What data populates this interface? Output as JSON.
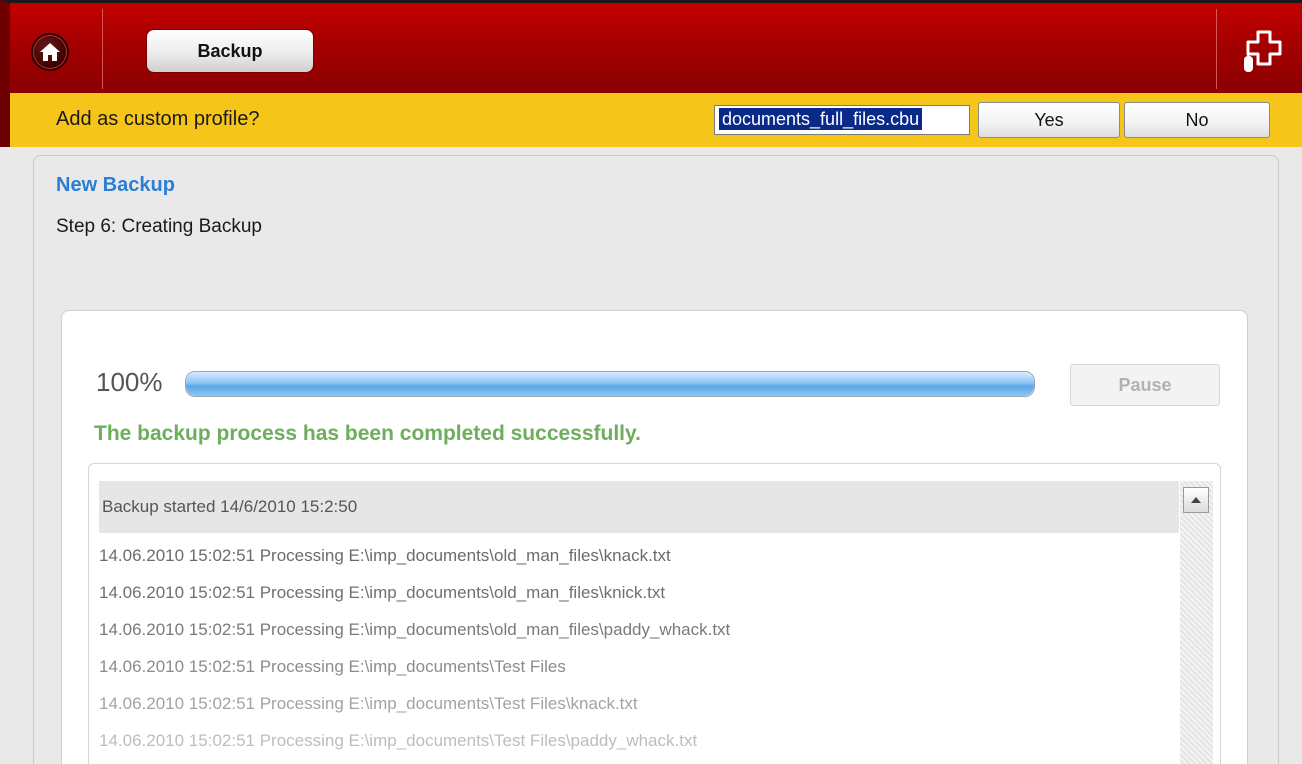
{
  "toolbar": {
    "home_icon": "home-icon",
    "backup_label": "Backup",
    "help_icon": "plug-help-icon"
  },
  "prompt": {
    "text": "Add as custom profile?",
    "profile_name": "documents_full_files.cbu",
    "yes_label": "Yes",
    "no_label": "No"
  },
  "panel": {
    "title": "New Backup",
    "subtitle": "Step 6: Creating Backup",
    "progress_label": "100%",
    "progress_value": 100,
    "pause_label": "Pause",
    "status": "The backup process has been completed successfully."
  },
  "log": {
    "header": "Backup started 14/6/2010 15:2:50",
    "lines": [
      {
        "text": "14.06.2010 15:02:51 Processing E:\\imp_documents\\old_man_files\\knack.txt",
        "color": "#6b6b6b"
      },
      {
        "text": "14.06.2010 15:02:51 Processing E:\\imp_documents\\old_man_files\\knick.txt",
        "color": "#707070"
      },
      {
        "text": "14.06.2010 15:02:51 Processing E:\\imp_documents\\old_man_files\\paddy_whack.txt",
        "color": "#7a7a7a"
      },
      {
        "text": "14.06.2010 15:02:51 Processing E:\\imp_documents\\Test Files",
        "color": "#8c8c8c"
      },
      {
        "text": "14.06.2010 15:02:51 Processing E:\\imp_documents\\Test Files\\knack.txt",
        "color": "#a3a3a3"
      },
      {
        "text": "14.06.2010 15:02:51 Processing E:\\imp_documents\\Test Files\\paddy_whack.txt",
        "color": "#bdbdbd"
      }
    ]
  },
  "colors": {
    "topbar": "#a50000",
    "promptbar": "#f6c51a",
    "title_blue": "#2a7fd4",
    "success_green": "#6cae5c"
  }
}
